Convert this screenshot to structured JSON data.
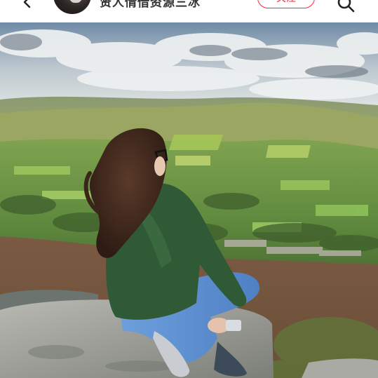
{
  "header": {
    "username": "贤人情借资源三冰",
    "follow_label": "关注"
  },
  "icons": {
    "back": "chevron-left-icon",
    "search": "search-icon"
  },
  "photo": {
    "subject": "woman-sitting-on-rock-overlooking-valley"
  },
  "colors": {
    "accent": "#ff2442",
    "sky": "#8fa9c2",
    "jacket": "#2f5a35",
    "jeans": "#5d8fd0"
  }
}
